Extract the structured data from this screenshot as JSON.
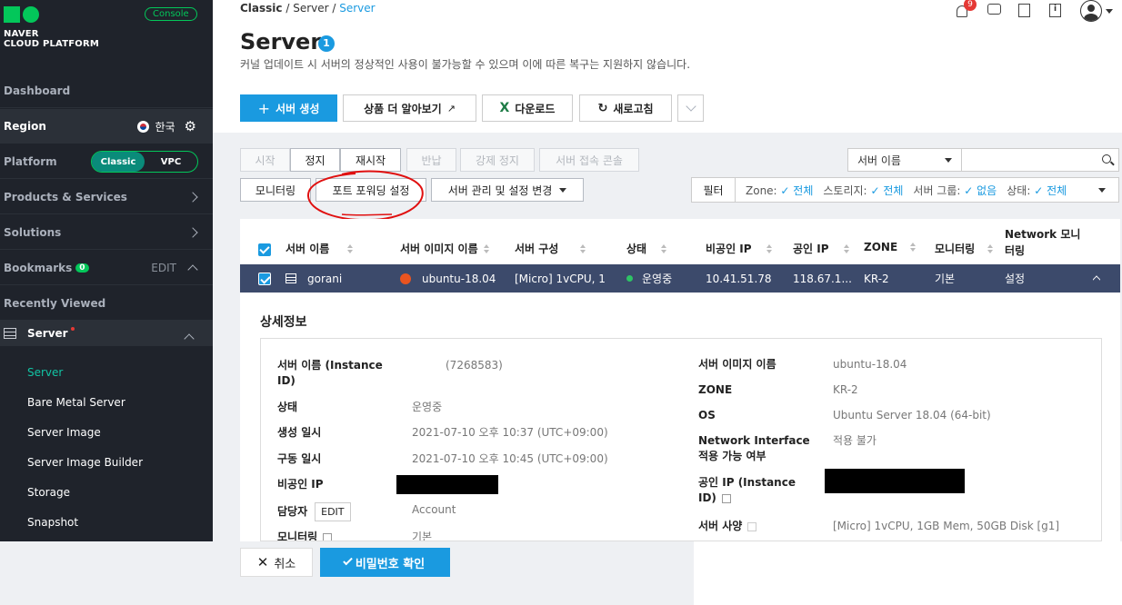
{
  "colors": {
    "accent": "#1a9ae0",
    "brand_green": "#03c75a",
    "sidebar_bg": "#1f232b",
    "selected_row": "#3c4a6b",
    "annotation_red": "#e01010"
  },
  "sidebar": {
    "logo_line1": "NAVER",
    "logo_line2": "CLOUD PLATFORM",
    "console_badge": "Console",
    "dashboard": "Dashboard",
    "region_label": "Region",
    "region_value": "한국",
    "platform_label": "Platform",
    "platform_options": [
      "Classic",
      "VPC"
    ],
    "products": "Products & Services",
    "solutions": "Solutions",
    "bookmarks": "Bookmarks",
    "bookmarks_count": "0",
    "bookmarks_edit": "EDIT",
    "recently_viewed": "Recently Viewed",
    "server_group": "Server",
    "server_items": [
      "Server",
      "Bare Metal Server",
      "Server Image",
      "Server Image Builder",
      "Storage",
      "Snapshot"
    ]
  },
  "header": {
    "breadcrumb": [
      "Classic",
      "Server",
      "Server"
    ],
    "notification_count": "9"
  },
  "page": {
    "title": "Server",
    "title_badge": "1",
    "notice": "커널 업데이트 시 서버의 정상적인 사용이 불가능할 수 있으며 이에 따른 복구는 지원하지 않습니다."
  },
  "toolbar": {
    "create": "서버 생성",
    "learn_more": "상품 더 알아보기",
    "download": "다운로드",
    "refresh": "새로고침"
  },
  "actions": {
    "start": "시작",
    "stop": "정지",
    "restart": "재시작",
    "return": "반납",
    "force_stop": "강제 정지",
    "console": "서버 접속 콘솔",
    "monitoring": "모니터링",
    "port_forwarding": "포트 포워딩 설정",
    "manage": "서버 관리 및 설정 변경"
  },
  "search": {
    "select_value": "서버 이름"
  },
  "filter": {
    "label": "필터",
    "items": [
      {
        "key": "Zone:",
        "value": "전체"
      },
      {
        "key": "스토리지:",
        "value": "전체"
      },
      {
        "key": "서버 그룹:",
        "value": "없음"
      },
      {
        "key": "상태:",
        "value": "전체"
      }
    ]
  },
  "table": {
    "columns": [
      "서버 이름",
      "서버 이미지 이름",
      "서버 구성",
      "상태",
      "비공인 IP",
      "공인 IP",
      "ZONE",
      "모니터링",
      "Network 모니",
      "터링"
    ],
    "row": {
      "name": "gorani",
      "image": "ubuntu-18.04",
      "spec": "[Micro] 1vCPU, 1...",
      "status": "운영중",
      "private_ip": "10.41.51.78",
      "public_ip": "118.67.1...",
      "zone": "KR-2",
      "monitoring": "기본",
      "network_monitoring": "설정"
    }
  },
  "detail": {
    "title": "상세정보",
    "left": [
      {
        "label": "서버 이름 (Instance",
        "label2": "ID)",
        "value": "(7268583)"
      },
      {
        "label": "상태",
        "value": "운영중"
      },
      {
        "label": "생성 일시",
        "value": "2021-07-10 오후 10:37 (UTC+09:00)"
      },
      {
        "label": "구동 일시",
        "value": "2021-07-10 오후 10:45 (UTC+09:00)"
      },
      {
        "label": "비공인 IP",
        "value": ""
      },
      {
        "label": "담당자",
        "edit": "EDIT",
        "value": "Account"
      },
      {
        "label": "모니터링",
        "value": "기본"
      }
    ],
    "right": [
      {
        "label": "서버 이미지 이름",
        "value": "ubuntu-18.04"
      },
      {
        "label": "ZONE",
        "value": "KR-2"
      },
      {
        "label": "OS",
        "value": "Ubuntu Server 18.04 (64-bit)"
      },
      {
        "label": "Network Interface",
        "label2": "적용 가능 여부",
        "value": "적용 불가"
      },
      {
        "label": "공인 IP (Instance",
        "label2": "ID)",
        "value": ""
      },
      {
        "label": "서버 사양",
        "value": "[Micro] 1vCPU, 1GB Mem, 50GB Disk [g1]"
      }
    ]
  },
  "footer": {
    "cancel": "취소",
    "confirm": "비밀번호 확인"
  }
}
